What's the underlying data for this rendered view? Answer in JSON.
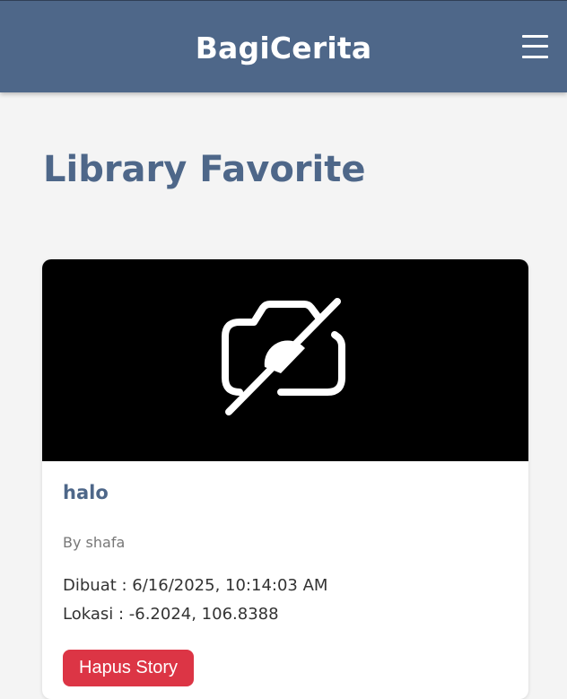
{
  "header": {
    "brand": "BagiCerita",
    "menu_icon": "hamburger-menu-icon",
    "bg_color": "#4e6789"
  },
  "page": {
    "title": "Library Favorite"
  },
  "stories": [
    {
      "image_icon": "no-camera-icon",
      "title": "halo",
      "author": "By shafa",
      "created": "Dibuat : 6/16/2025, 10:14:03 AM",
      "location": "Lokasi : -6.2024, 106.8388",
      "delete_label": "Hapus Story",
      "delete_color": "#dc3545"
    }
  ]
}
